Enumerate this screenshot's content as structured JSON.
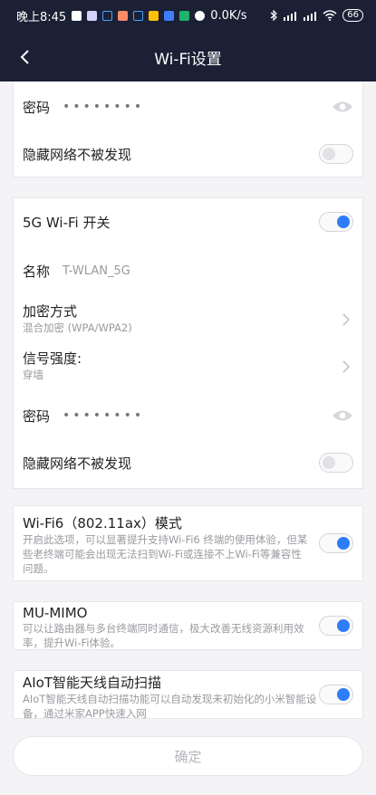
{
  "status_bar": {
    "time": "晚上8:45",
    "net_speed": "0.0K/s",
    "battery": "66"
  },
  "header": {
    "title": "Wi-Fi设置"
  },
  "card_24g": {
    "password_label": "密码",
    "password_mask": "••••••••",
    "hide_label": "隐藏网络不被发现",
    "hide_enabled": false
  },
  "card_5g": {
    "switch_label": "5G Wi-Fi 开关",
    "switch_enabled": true,
    "name_label": "名称",
    "name_value": "T-WLAN_5G",
    "encryption_label": "加密方式",
    "encryption_value": "混合加密 (WPA/WPA2)",
    "signal_label": "信号强度:",
    "signal_value": "穿墙",
    "password_label": "密码",
    "password_mask": "••••••••",
    "hide_label": "隐藏网络不被发现",
    "hide_enabled": false
  },
  "wifi6": {
    "title": "Wi-Fi6（802.11ax）模式",
    "desc": "开启此选项，可以显著提升支持Wi-Fi6 终端的使用体验，但某些老终端可能会出现无法扫到Wi-Fi或连接不上Wi-Fi等兼容性问题。",
    "enabled": true
  },
  "mumimo": {
    "title": "MU-MIMO",
    "desc": "可以让路由器与多台终端同时通信，极大改善无线资源利用效率，提升Wi-Fi体验。",
    "enabled": true
  },
  "aiot": {
    "title": "AIoT智能天线自动扫描",
    "desc": "AIoT智能天线自动扫描功能可以自动发现未初始化的小米智能设备，通过米家APP快速入网",
    "enabled": true
  },
  "confirm_label": "确定",
  "colors": {
    "header_bg": "#1b2035",
    "accent": "#2f7df6"
  },
  "icons": [
    "back-arrow-icon",
    "eye-icon",
    "chevron-right-icon",
    "wifi-icon",
    "bluetooth-icon",
    "signal-icon",
    "battery-icon"
  ]
}
